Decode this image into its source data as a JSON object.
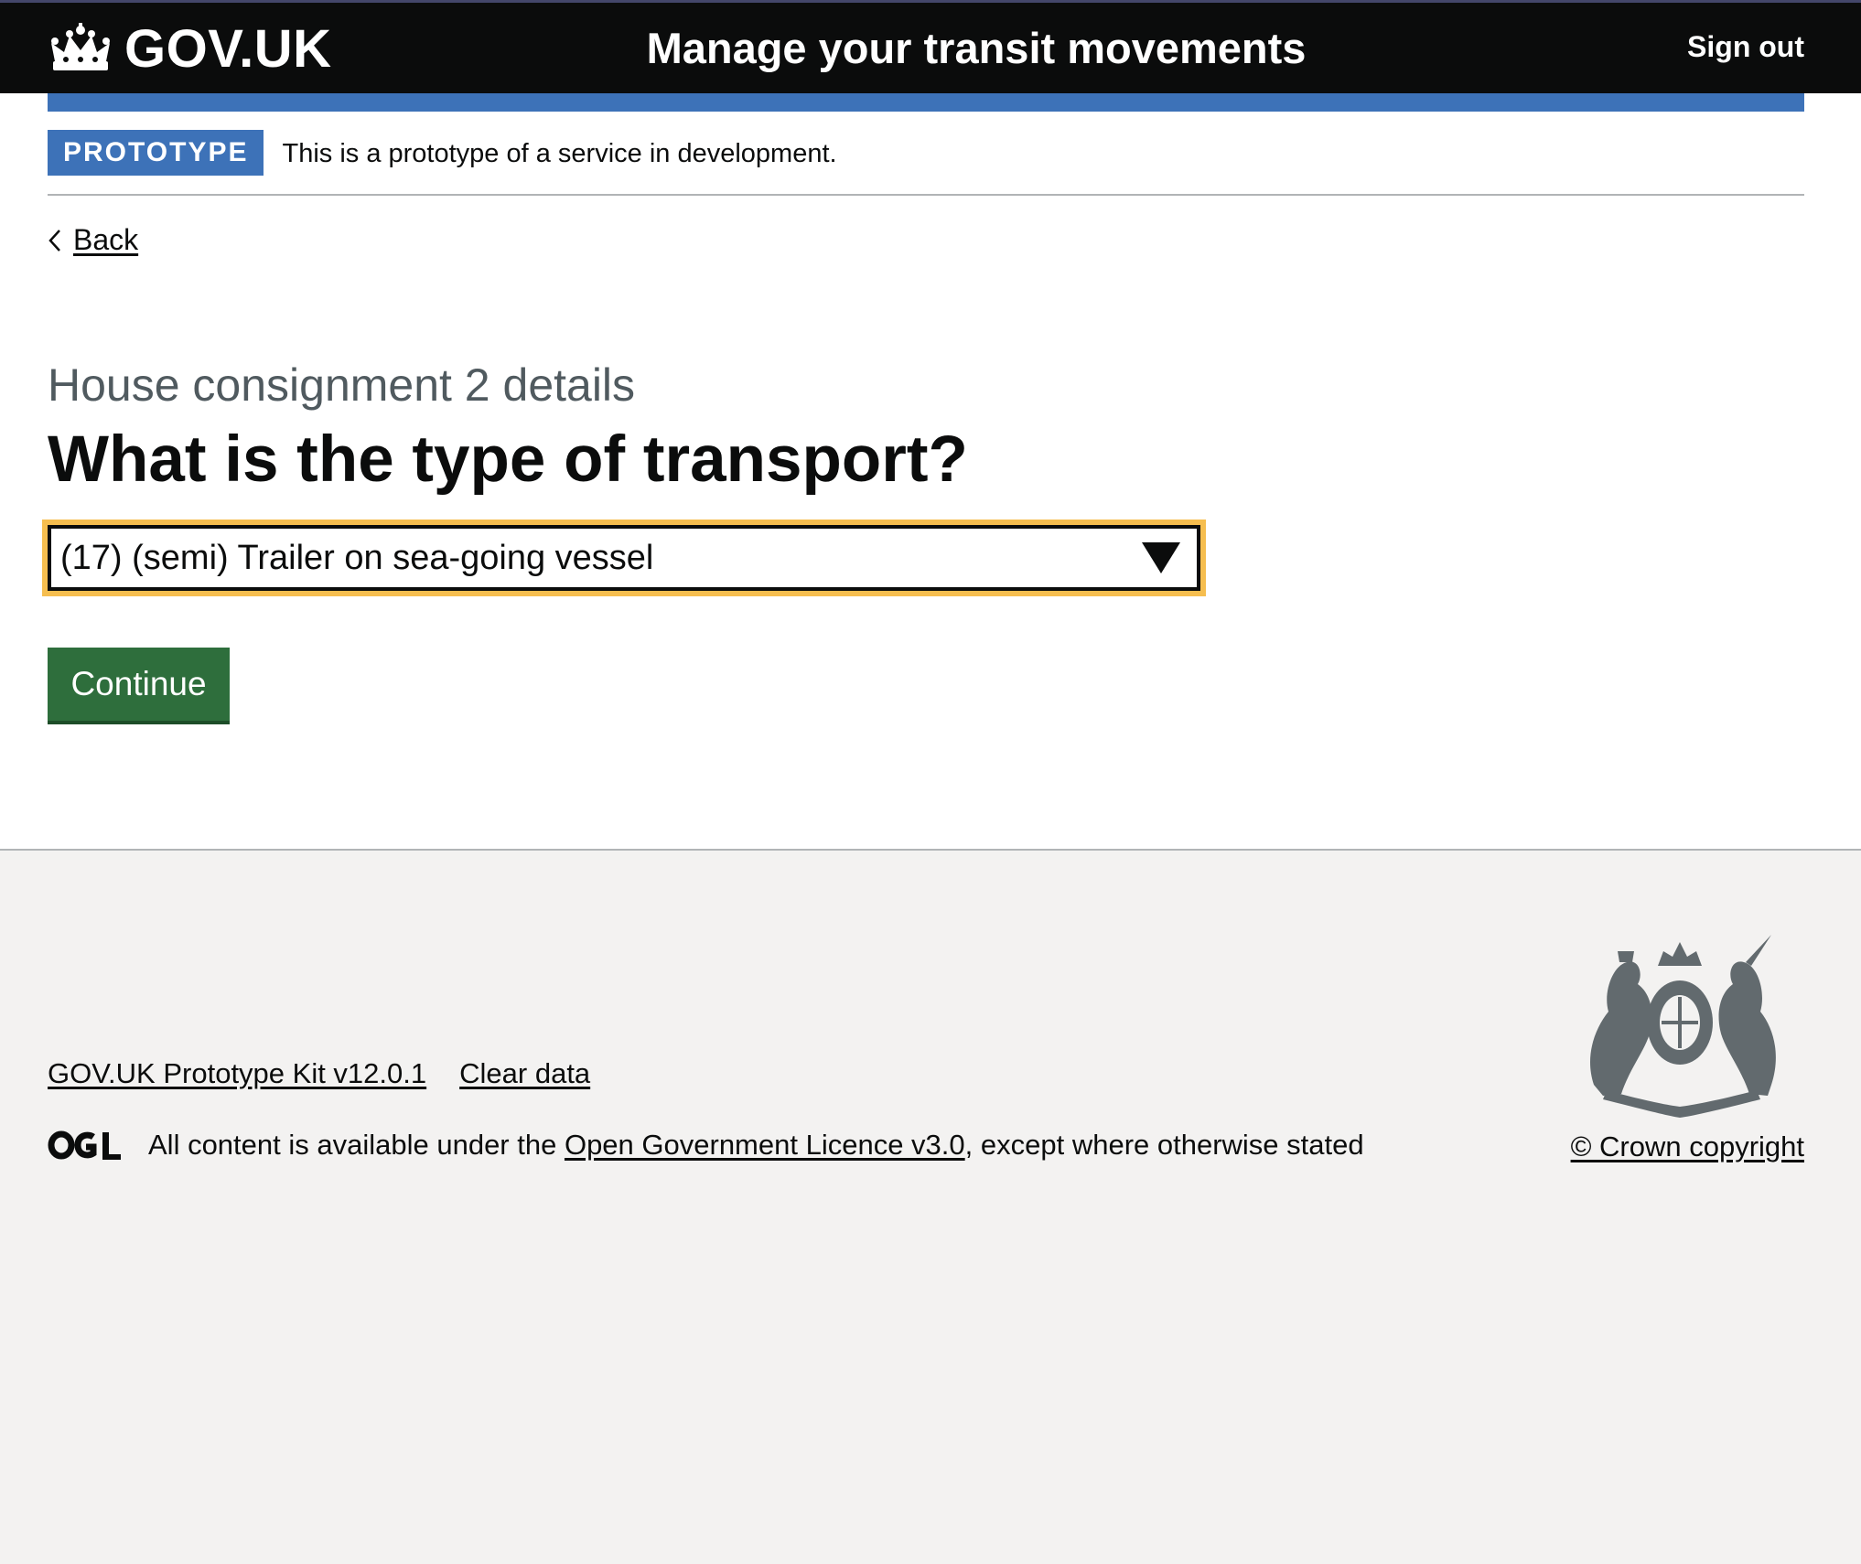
{
  "header": {
    "logo_text": "GOV.UK",
    "service_name": "Manage your transit movements",
    "sign_out_label": "Sign out"
  },
  "phase_banner": {
    "tag": "PROTOTYPE",
    "text": "This is a prototype of a service in development."
  },
  "back_link": {
    "label": "Back"
  },
  "form": {
    "caption": "House consignment 2 details",
    "heading": "What is the type of transport?",
    "select_value": "(17) (semi) Trailer on sea-going vessel",
    "continue_label": "Continue"
  },
  "footer": {
    "links": [
      "GOV.UK Prototype Kit v12.0.1",
      "Clear data"
    ],
    "licence_prefix": "All content is available under the ",
    "licence_link": "Open Government Licence v3.0",
    "licence_suffix": ", except where otherwise stated",
    "copyright": "© Crown copyright"
  },
  "colors": {
    "header_bg": "#0b0c0c",
    "brand_blue": "#3d72b8",
    "focus_yellow": "#f6be4f",
    "button_green": "#2e6e3c",
    "footer_bg": "#f3f2f1"
  },
  "icons": [
    "crown-icon",
    "chevron-left-icon",
    "triangle-down-icon",
    "ogl-logo-icon",
    "royal-coat-of-arms-icon"
  ]
}
